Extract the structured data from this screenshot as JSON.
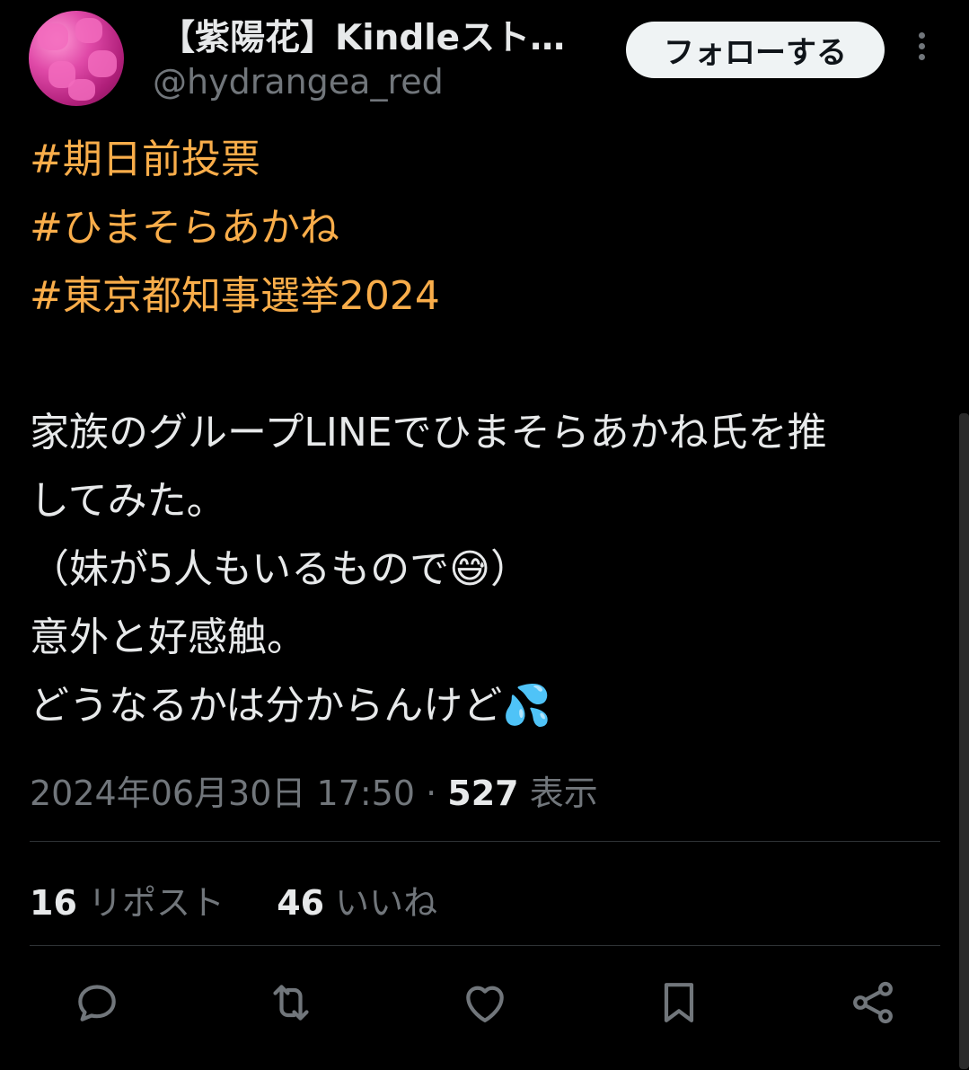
{
  "user": {
    "display_name": "【紫陽花】Kindleスト…",
    "handle": "@hydrangea_red",
    "follow_label": "フォローする"
  },
  "tweet": {
    "hashtags": [
      "#期日前投票",
      "#ひまそらあかね",
      "#東京都知事選挙2024"
    ],
    "lines": [
      "家族のグループLINEでひまそらあかね氏を推",
      "してみた。",
      "（妹が5人もいるもので😅）",
      "意外と好感触。",
      "どうなるかは分からんけど💦"
    ]
  },
  "meta": {
    "datetime": "2024年06月30日 17:50",
    "separator": "·",
    "views": "527",
    "views_label": "表示"
  },
  "stats": {
    "reposts": "16",
    "reposts_label": "リポスト",
    "likes": "46",
    "likes_label": "いいね"
  },
  "actions": [
    "reply-icon",
    "repost-icon",
    "like-icon",
    "bookmark-icon",
    "share-icon"
  ],
  "colors": {
    "hashtag": "#f9ad4a",
    "text": "#e7e9ea",
    "muted": "#71767b",
    "background": "#000000",
    "divider": "#2f3336"
  }
}
